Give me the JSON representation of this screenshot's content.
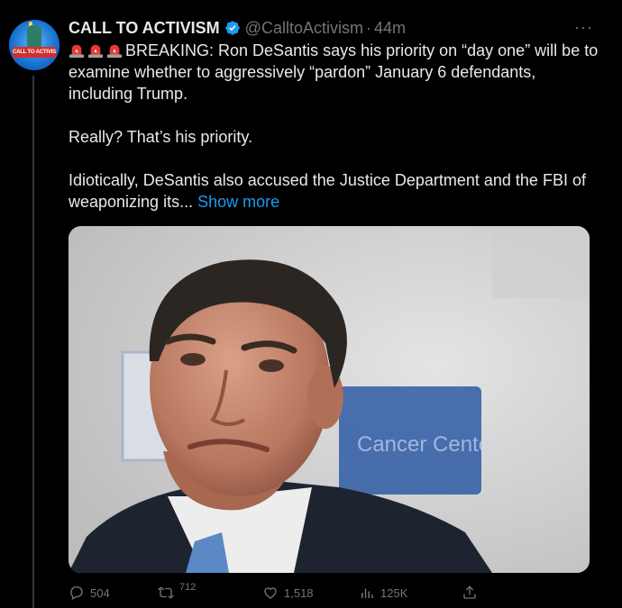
{
  "tweet": {
    "avatar_text": "CALL TO ACTIVISM",
    "display_name": "CALL TO ACTIVISM",
    "handle": "@CalltoActivism",
    "separator": "·",
    "time": "44m",
    "more_label": "···",
    "paragraph1": "BREAKING: Ron DeSantis says his priority on “day one” will be to examine whether to aggressively “pardon” January 6 defendants, including Trump.",
    "paragraph2": "Really? That’s his priority.",
    "paragraph3": "Idiotically, DeSantis also accused the Justice Department and the FBI of weaponizing its...",
    "show_more": "Show more",
    "media_bg_text": "Cancer Center"
  },
  "actions": {
    "replies": "504",
    "reposts": "712",
    "likes": "1,518",
    "views": "125K"
  },
  "colors": {
    "background": "#000000",
    "text": "#e7e9ea",
    "muted": "#71767b",
    "link": "#1d9bf0",
    "verified": "#1d9bf0",
    "siren": "#e53935"
  },
  "icons": [
    "verified-badge-icon",
    "siren-icon",
    "more-icon",
    "reply-icon",
    "repost-icon",
    "like-icon",
    "views-icon",
    "share-icon"
  ]
}
